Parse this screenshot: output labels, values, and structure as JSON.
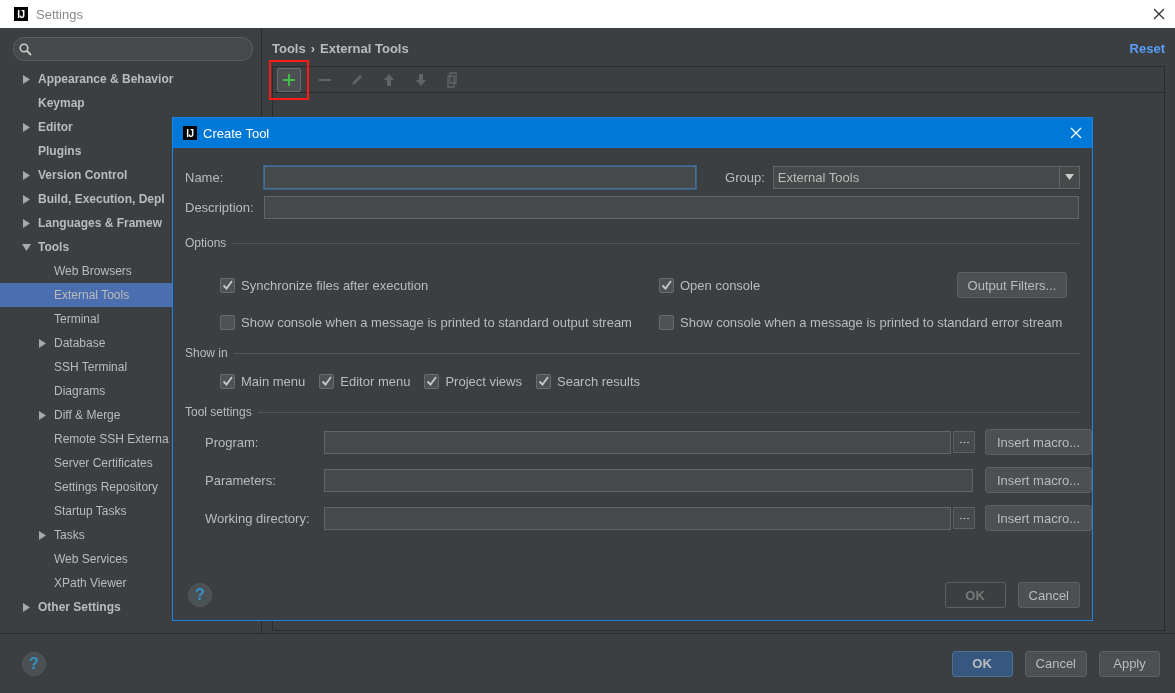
{
  "window": {
    "logo": "IJ",
    "title": "Settings"
  },
  "sidebar": {
    "items": [
      {
        "label": "Appearance & Behavior",
        "kind": "folder",
        "expanded": false,
        "selected": false
      },
      {
        "label": "Keymap",
        "kind": "leaf",
        "selected": false
      },
      {
        "label": "Editor",
        "kind": "folder",
        "expanded": false,
        "selected": false
      },
      {
        "label": "Plugins",
        "kind": "leaf",
        "selected": false
      },
      {
        "label": "Version Control",
        "kind": "folder",
        "expanded": false,
        "selected": false
      },
      {
        "label": "Build, Execution, Depl",
        "kind": "folder",
        "expanded": false,
        "selected": false
      },
      {
        "label": "Languages & Framew",
        "kind": "folder",
        "expanded": false,
        "selected": false
      },
      {
        "label": "Tools",
        "kind": "folder",
        "expanded": true,
        "selected": false,
        "children": [
          {
            "label": "Web Browsers",
            "kind": "leaf",
            "selected": false
          },
          {
            "label": "External Tools",
            "kind": "leaf",
            "selected": true
          },
          {
            "label": "Terminal",
            "kind": "leaf",
            "selected": false
          },
          {
            "label": "Database",
            "kind": "folder",
            "expanded": false,
            "selected": false
          },
          {
            "label": "SSH Terminal",
            "kind": "leaf",
            "selected": false
          },
          {
            "label": "Diagrams",
            "kind": "leaf",
            "selected": false
          },
          {
            "label": "Diff & Merge",
            "kind": "folder",
            "expanded": false,
            "selected": false
          },
          {
            "label": "Remote SSH Externa",
            "kind": "leaf",
            "selected": false
          },
          {
            "label": "Server Certificates",
            "kind": "leaf",
            "selected": false
          },
          {
            "label": "Settings Repository",
            "kind": "leaf",
            "selected": false
          },
          {
            "label": "Startup Tasks",
            "kind": "leaf",
            "selected": false
          },
          {
            "label": "Tasks",
            "kind": "folder",
            "expanded": false,
            "selected": false
          },
          {
            "label": "Web Services",
            "kind": "leaf",
            "selected": false
          },
          {
            "label": "XPath Viewer",
            "kind": "leaf",
            "selected": false
          }
        ]
      },
      {
        "label": "Other Settings",
        "kind": "folder",
        "expanded": false,
        "selected": false
      }
    ]
  },
  "breadcrumb": [
    "Tools",
    "›",
    "External Tools"
  ],
  "reset": "Reset",
  "toolbar": [
    {
      "kind": "add",
      "disabled": false,
      "highlighted": true
    },
    {
      "kind": "remove",
      "disabled": true,
      "highlighted": false
    },
    {
      "kind": "edit",
      "disabled": true,
      "highlighted": false
    },
    {
      "kind": "up",
      "disabled": true,
      "highlighted": false
    },
    {
      "kind": "down",
      "disabled": true,
      "highlighted": false
    },
    {
      "kind": "copy",
      "disabled": true,
      "highlighted": false
    }
  ],
  "dialog": {
    "logo": "IJ",
    "title": "Create Tool",
    "name": {
      "label": "Name:",
      "focused": true
    },
    "group": {
      "label": "Group:",
      "value": "External Tools"
    },
    "description": {
      "label": "Description:"
    },
    "options": {
      "title": "Options",
      "checks": [
        {
          "label": "Synchronize files after execution",
          "checked": true
        },
        {
          "label": "Open console",
          "checked": true
        },
        {
          "label": "Show console when a message is printed to standard output stream",
          "checked": false
        },
        {
          "label": "Show console when a message is printed to standard error stream",
          "checked": false
        }
      ],
      "button": "Output Filters..."
    },
    "show_in": {
      "title": "Show in",
      "checks": [
        {
          "label": "Main menu",
          "checked": true
        },
        {
          "label": "Editor menu",
          "checked": true
        },
        {
          "label": "Project views",
          "checked": true
        },
        {
          "label": "Search results",
          "checked": true
        }
      ]
    },
    "tool_settings": {
      "title": "Tool settings",
      "rows": [
        {
          "label": "Program:",
          "browse": true,
          "button": "Insert macro..."
        },
        {
          "label": "Parameters:",
          "browse": false,
          "button": "Insert macro..."
        },
        {
          "label": "Working directory:",
          "browse": true,
          "button": "Insert macro..."
        }
      ]
    },
    "help": "?",
    "buttons": [
      {
        "label": "OK",
        "disabled": true
      },
      {
        "label": "Cancel",
        "disabled": false
      }
    ]
  },
  "footer": {
    "help": "?",
    "buttons": [
      {
        "label": "OK",
        "disabled": false,
        "default": true
      },
      {
        "label": "Cancel",
        "disabled": false,
        "default": false
      },
      {
        "label": "Apply",
        "disabled": false,
        "default": false
      }
    ]
  }
}
